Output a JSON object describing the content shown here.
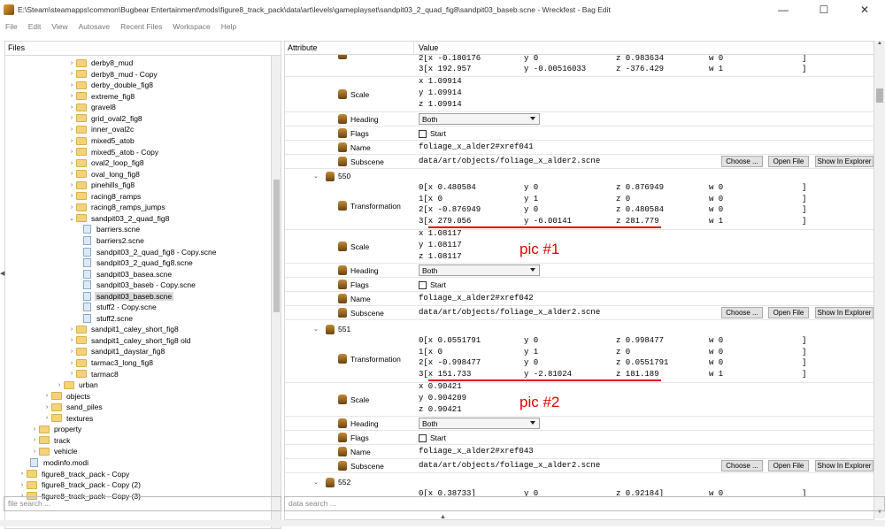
{
  "window": {
    "title": "E:\\Steam\\steamapps\\common\\Bugbear Entertainment\\mods\\figure8_track_pack\\data\\art\\levels\\gameplayset\\sandpit03_2_quad_fig8\\sandpit03_baseb.scne - Wreckfest - Bag Edit",
    "minimize": "—",
    "maximize": "☐",
    "close": "✕"
  },
  "menu": [
    "File",
    "Edit",
    "View",
    "Autosave",
    "Recent Files",
    "Workspace",
    "Help"
  ],
  "files": {
    "header": "Files",
    "search_placeholder": "file search ...",
    "tree": [
      {
        "label": "derby8_mud",
        "type": "folder",
        "depth": 4
      },
      {
        "label": "derby8_mud - Copy",
        "type": "folder",
        "depth": 4
      },
      {
        "label": "derby_double_fig8",
        "type": "folder",
        "depth": 4
      },
      {
        "label": "extreme_fig8",
        "type": "folder",
        "depth": 4
      },
      {
        "label": "gravel8",
        "type": "folder",
        "depth": 4
      },
      {
        "label": "grid_oval2_fig8",
        "type": "folder",
        "depth": 4
      },
      {
        "label": "inner_oval2c",
        "type": "folder",
        "depth": 4
      },
      {
        "label": "mixed5_atob",
        "type": "folder",
        "depth": 4
      },
      {
        "label": "mixed5_atob - Copy",
        "type": "folder",
        "depth": 4
      },
      {
        "label": "oval2_loop_fig8",
        "type": "folder",
        "depth": 4
      },
      {
        "label": "oval_long_fig8",
        "type": "folder",
        "depth": 4
      },
      {
        "label": "pinehills_fig8",
        "type": "folder",
        "depth": 4
      },
      {
        "label": "racing8_ramps",
        "type": "folder",
        "depth": 4
      },
      {
        "label": "racing8_ramps_jumps",
        "type": "folder",
        "depth": 4
      },
      {
        "label": "sandpit03_2_quad_fig8",
        "type": "folder",
        "depth": 4,
        "expanded": true
      },
      {
        "label": "barriers.scne",
        "type": "file",
        "depth": 5
      },
      {
        "label": "barriers2.scne",
        "type": "file",
        "depth": 5
      },
      {
        "label": "sandpit03_2_quad_fig8 - Copy.scne",
        "type": "file",
        "depth": 5
      },
      {
        "label": "sandpit03_2_quad_fig8.scne",
        "type": "file",
        "depth": 5
      },
      {
        "label": "sandpit03_basea.scne",
        "type": "file",
        "depth": 5
      },
      {
        "label": "sandpit03_baseb - Copy.scne",
        "type": "file",
        "depth": 5
      },
      {
        "label": "sandpit03_baseb.scne",
        "type": "file",
        "depth": 5,
        "selected": true
      },
      {
        "label": "stuff2 - Copy.scne",
        "type": "file",
        "depth": 5
      },
      {
        "label": "stuff2.scne",
        "type": "file",
        "depth": 5
      },
      {
        "label": "sandpit1_caley_short_fig8",
        "type": "folder",
        "depth": 4
      },
      {
        "label": "sandpit1_caley_short_fig8 old",
        "type": "folder",
        "depth": 4
      },
      {
        "label": "sandpit1_daystar_fig8",
        "type": "folder",
        "depth": 4
      },
      {
        "label": "tarmac3_long_fig8",
        "type": "folder",
        "depth": 4
      },
      {
        "label": "tarmac8",
        "type": "folder",
        "depth": 4
      },
      {
        "label": "urban",
        "type": "folder",
        "depth": 3
      },
      {
        "label": "objects",
        "type": "folder",
        "depth": 2
      },
      {
        "label": "sand_piles",
        "type": "folder",
        "depth": 2
      },
      {
        "label": "textures",
        "type": "folder",
        "depth": 2
      },
      {
        "label": "property",
        "type": "folder",
        "depth": 1
      },
      {
        "label": "track",
        "type": "folder",
        "depth": 1
      },
      {
        "label": "vehicle",
        "type": "folder",
        "depth": 1
      },
      {
        "label": "modinfo.modi",
        "type": "file",
        "depth": 1
      },
      {
        "label": "figure8_track_pack - Copy",
        "type": "folder",
        "depth": 0
      },
      {
        "label": "figure8_track_pack - Copy (2)",
        "type": "folder",
        "depth": 0
      },
      {
        "label": "figure8_track_pack - Copy (3)",
        "type": "folder",
        "depth": 0
      }
    ]
  },
  "attributes": {
    "col_attribute": "Attribute",
    "col_value": "Value",
    "search_placeholder": "data search ...",
    "top_rows": [
      [
        "2[x -0.180176",
        "y 0",
        "z 0.983634",
        "w 0",
        "]"
      ],
      [
        "3[x 192.957",
        "y -0.00516033",
        "z -376.429",
        "w 1",
        "]"
      ]
    ],
    "scale0": {
      "label": "Scale",
      "lines": [
        "x 1.09914",
        "y 1.09914",
        "z 1.09914"
      ]
    },
    "heading0": {
      "label": "Heading",
      "value": "Both"
    },
    "flags0": {
      "label": "Flags",
      "check_label": "Start"
    },
    "name0": {
      "label": "Name",
      "value": "foliage_x_alder2#xref041"
    },
    "subscene0": {
      "label": "Subscene",
      "value": "data/art/objects/foliage_x_alder2.scne"
    },
    "buttons": {
      "choose": "Choose ...",
      "open": "Open File",
      "explorer": "Show In Explorer"
    },
    "groups": [
      {
        "id": "550",
        "transform_label": "Transformation",
        "rows": [
          [
            "0[x 0.480584",
            "y 0",
            "z 0.876949",
            "w 0",
            "]"
          ],
          [
            "1[x 0",
            "y 1",
            "z 0",
            "w 0",
            "]"
          ],
          [
            "2[x -0.876949",
            "y 0",
            "z 0.480584",
            "w 0",
            "]"
          ],
          [
            "3[x 279.056",
            "y -6.00141",
            "z 281.779",
            "w 1",
            "]"
          ]
        ],
        "scale_label": "Scale",
        "scale": [
          "x 1.08117",
          "y 1.08117",
          "z 1.08117"
        ],
        "heading_label": "Heading",
        "heading": "Both",
        "flags_label": "Flags",
        "flag": "Start",
        "name_label": "Name",
        "name": "foliage_x_alder2#xref042",
        "subscene_label": "Subscene",
        "subscene": "data/art/objects/foliage_x_alder2.scne",
        "annotation": "pic #1"
      },
      {
        "id": "551",
        "transform_label": "Transformation",
        "rows": [
          [
            "0[x 0.0551791",
            "y 0",
            "z 0.998477",
            "w 0",
            "]"
          ],
          [
            "1[x 0",
            "y 1",
            "z 0",
            "w 0",
            "]"
          ],
          [
            "2[x -0.998477",
            "y 0",
            "z 0.0551791",
            "w 0",
            "]"
          ],
          [
            "3[x 151.733",
            "y -2.81024",
            "z 181.189",
            "w 1",
            "]"
          ]
        ],
        "scale_label": "Scale",
        "scale": [
          "x 0.90421",
          "y 0.904209",
          "z 0.90421"
        ],
        "heading_label": "Heading",
        "heading": "Both",
        "flags_label": "Flags",
        "flag": "Start",
        "name_label": "Name",
        "name": "foliage_x_alder2#xref043",
        "subscene_label": "Subscene",
        "subscene": "data/art/objects/foliage_x_alder2.scne",
        "annotation": "pic #2"
      },
      {
        "id": "552",
        "rows": [
          [
            "0[x 0.38733]",
            "y 0",
            "z 0.92184]",
            "w 0",
            "]"
          ]
        ]
      }
    ]
  },
  "colors": {
    "annotation": "#e30000",
    "selection": "#d9d9d9",
    "folder": "#f3d27a"
  }
}
